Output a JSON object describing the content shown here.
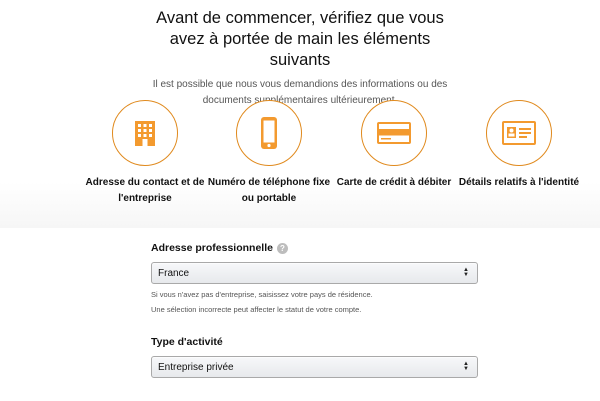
{
  "header": {
    "title": "Avant de commencer, vérifiez que vous avez à portée de main les éléments suivants",
    "subtitle": "Il est possible que nous vous demandions des informations ou des documents supplémentaires ultérieurement."
  },
  "requirements": [
    {
      "label": "Adresse du contact et de l'entreprise",
      "icon": "building-icon"
    },
    {
      "label": "Numéro de téléphone fixe ou portable",
      "icon": "phone-icon"
    },
    {
      "label": "Carte de crédit à débiter",
      "icon": "credit-card-icon"
    },
    {
      "label": "Détails relatifs à l'identité",
      "icon": "id-card-icon"
    }
  ],
  "form": {
    "business_address": {
      "label": "Adresse professionnelle",
      "value": "France",
      "hint_line1": "Si vous n'avez pas d'entreprise, saisissez votre pays de résidence.",
      "hint_line2": "Une sélection incorrecte peut affecter le statut de votre compte."
    },
    "activity_type": {
      "label": "Type d'activité",
      "value": "Entreprise privée"
    }
  },
  "colors": {
    "accent_orange": "#e08a1e",
    "icon_fill": "#f39a2f"
  }
}
